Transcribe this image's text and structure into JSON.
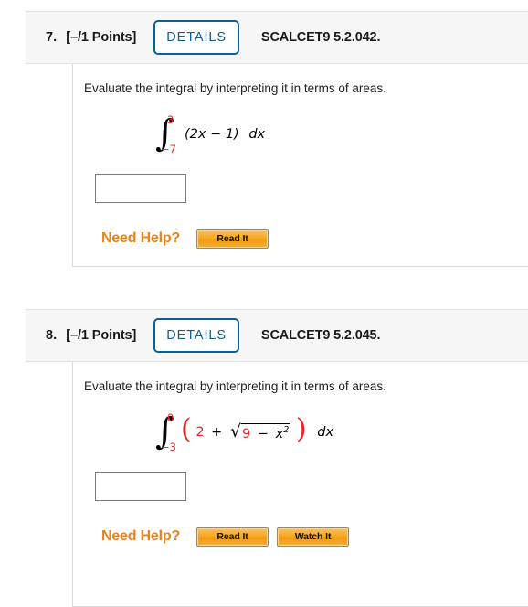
{
  "questions": [
    {
      "number": "7.",
      "points": "[–/1 Points]",
      "details_label": "DETAILS",
      "code": "SCALCET9 5.2.042.",
      "prompt": "Evaluate the integral by interpreting it in terms of areas.",
      "integral": {
        "upper_limit": "3",
        "lower_limit": "−7",
        "integrand": "(2x − 1)",
        "differential": "dx"
      },
      "answer_value": "",
      "help_label": "Need Help?",
      "help_buttons": [
        "Read It"
      ]
    },
    {
      "number": "8.",
      "points": "[–/1 Points]",
      "details_label": "DETAILS",
      "code": "SCALCET9 5.2.045.",
      "prompt": "Evaluate the integral by interpreting it in terms of areas.",
      "integral": {
        "upper_limit": "0",
        "lower_limit": "−3",
        "integrand_open_paren": "(",
        "integrand_term1": "2",
        "integrand_plus": "+",
        "radical_symbol": "√",
        "radicand_a": "9",
        "radicand_minus": "−",
        "radicand_b": "x",
        "radicand_exp": "2",
        "integrand_close_paren": ")",
        "differential": "dx"
      },
      "answer_value": "",
      "help_label": "Need Help?",
      "help_buttons": [
        "Read It",
        "Watch It"
      ]
    }
  ],
  "colors": {
    "accent_blue": "#0d6094",
    "help_orange": "#e8821c",
    "math_red": "#e8252a",
    "header_bg": "#f6f6f6"
  }
}
